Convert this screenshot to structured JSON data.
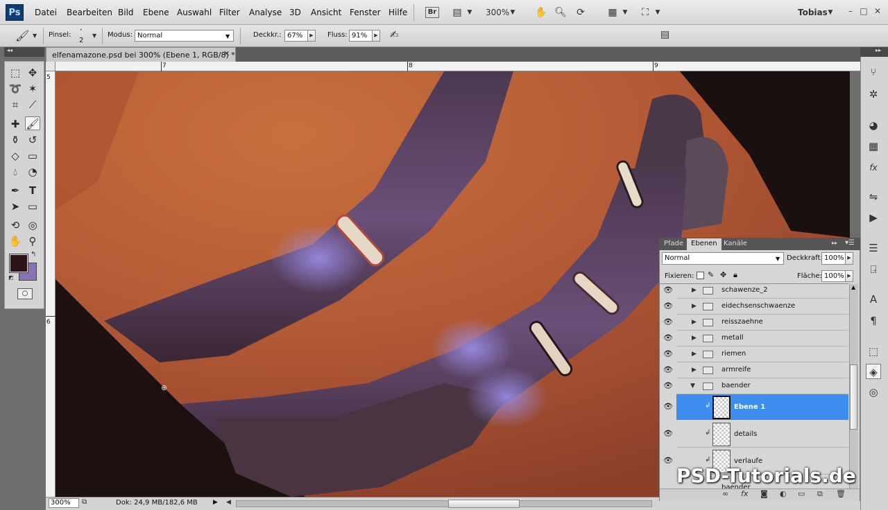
{
  "app": {
    "logo": "Ps",
    "user": "Tobias"
  },
  "menu": [
    "Datei",
    "Bearbeiten",
    "Bild",
    "Ebene",
    "Auswahl",
    "Filter",
    "Analyse",
    "3D",
    "Ansicht",
    "Fenster",
    "Hilfe"
  ],
  "menubar": {
    "bridge_label": "Br",
    "zoom": "300%"
  },
  "options": {
    "brush_label": "Pinsel:",
    "brush_size": "2",
    "mode_label": "Modus:",
    "mode_value": "Normal",
    "opacity_label": "Deckkr.:",
    "opacity_value": "67%",
    "flow_label": "Fluss:",
    "flow_value": "91%"
  },
  "document": {
    "tab_title": "elfenamazone.psd bei 300% (Ebene 1, RGB/8) *",
    "ruler_top": [
      "7",
      "8",
      "9"
    ],
    "ruler_left": [
      "5",
      "6"
    ]
  },
  "status": {
    "zoom": "300%",
    "doc_info": "Dok: 24,9 MB/182,6 MB"
  },
  "layers_panel": {
    "tabs": [
      "Pfade",
      "Ebenen",
      "Kanäle"
    ],
    "active_tab": "Ebenen",
    "blend_mode": "Normal",
    "opacity_label": "Deckkraft:",
    "opacity_value": "100%",
    "lock_label": "Fixieren:",
    "fill_label": "Fläche:",
    "fill_value": "100%",
    "groups": [
      "schawenze_2",
      "eidechsenschwaenze",
      "reisszaehne",
      "metall",
      "riemen",
      "armreife",
      "baender"
    ],
    "layers": [
      "Ebene 1",
      "details",
      "verlaufe"
    ],
    "partial_row": "baender",
    "selected_layer": "Ebene 1"
  },
  "watermark": "PSD-Tutorials.de",
  "colors": {
    "foreground": "#2e1416",
    "background": "#8872b6",
    "selection": "#3d8ef0"
  }
}
